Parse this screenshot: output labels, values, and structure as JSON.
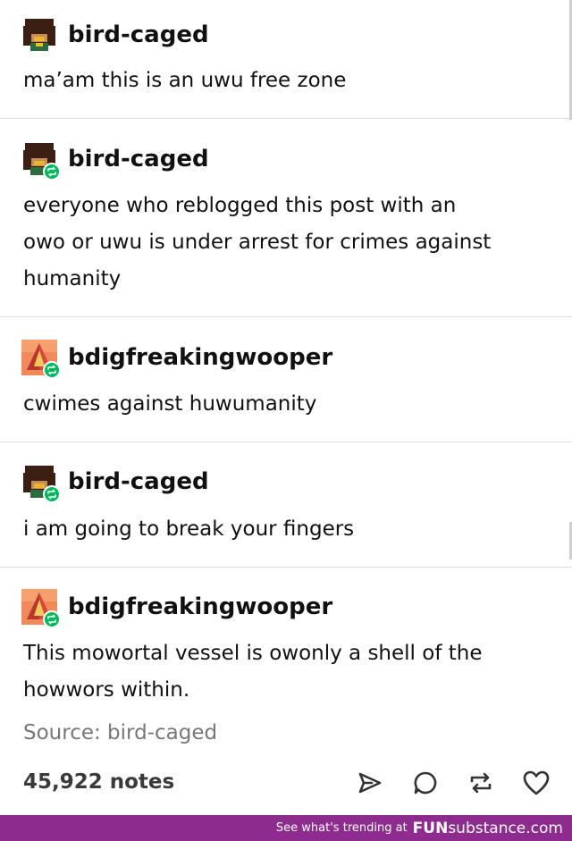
{
  "thread": [
    {
      "username": "bird-caged",
      "avatar": "dark-hair-pixel-avatar",
      "reblog": false,
      "text": "ma’am this is an uwu free zone"
    },
    {
      "username": "bird-caged",
      "avatar": "dark-hair-pixel-avatar",
      "reblog": true,
      "text_lines": [
        "everyone who reblogged this post with an",
        "owo or uwu is under arrest for crimes against",
        "humanity"
      ]
    },
    {
      "username": "bdigfreakingwooper",
      "avatar": "pyramid-pixel-avatar",
      "reblog": true,
      "text": "cwimes against huwumanity"
    },
    {
      "username": "bird-caged",
      "avatar": "dark-hair-pixel-avatar",
      "reblog": true,
      "text": "i am going to break your fingers"
    },
    {
      "username": "bdigfreakingwooper",
      "avatar": "pyramid-pixel-avatar",
      "reblog": true,
      "text_lines": [
        "This mowortal vessel is owonly a shell of the",
        "howwors within."
      ]
    }
  ],
  "source": "Source: bird-caged",
  "notes": "45,922 notes",
  "actions": [
    "share-icon",
    "reply-icon",
    "reblog-icon",
    "like-icon"
  ],
  "footer": {
    "trend_text": "See what's trending at",
    "brand_left": "FUN",
    "brand_right": "substance",
    "brand_suffix": ".com"
  },
  "colors": {
    "reblog_badge": "#00b85c",
    "footer_bg": "#8e2b8f",
    "divider": "#dedede"
  }
}
